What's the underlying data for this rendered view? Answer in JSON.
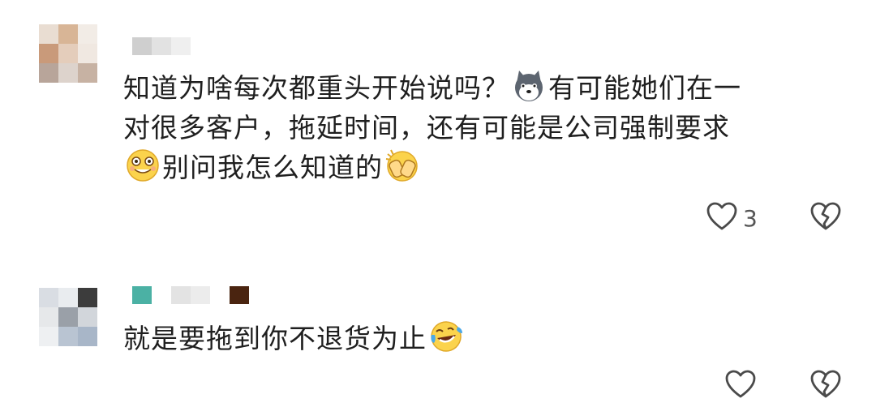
{
  "comments": [
    {
      "lines": [
        "知道为啥每次都重头开始说吗？",
        "有可能她们在一",
        "对很多客户，拖延时间，还有可能是公司强制要求",
        "别问我怎么知道的"
      ],
      "emojis": [
        "husky-dog-emoji",
        "grinning-teeth-emoji",
        "covering-face-emoji"
      ],
      "like_count": "3",
      "avatar_colors": [
        "#e9ddd2",
        "#d8b596",
        "#c99a7a",
        "#e4cdbb",
        "#c7b2a3",
        "#f0e8e1",
        "#b8a59a",
        "#ddd3cc",
        "#eee6df"
      ],
      "name_colors": [
        "#cfcfcf",
        "#e2e2e2",
        "#efefef"
      ]
    },
    {
      "lines": [
        "就是要拖到你不退货为止"
      ],
      "emojis": [
        "laughing-tears-emoji"
      ],
      "like_count": "",
      "avatar_colors": [
        "#d9dde3",
        "#e9ecef",
        "#3c3c3c",
        "#e6e8ea",
        "#9aa0a8",
        "#d2d6db",
        "#b9c4d2",
        "#eef0f2",
        "#a8b6c8"
      ],
      "name_colors": [
        "#4bb1a4",
        "#ffffff",
        "#e3e3e3",
        "#ececec",
        "#ffffff",
        "#4a2410"
      ]
    }
  ],
  "icons": {
    "like": "heart-outline-icon",
    "dislike": "broken-heart-icon"
  },
  "colors": {
    "icon_stroke": "#4a4a4a",
    "text": "#1f1f1f"
  }
}
